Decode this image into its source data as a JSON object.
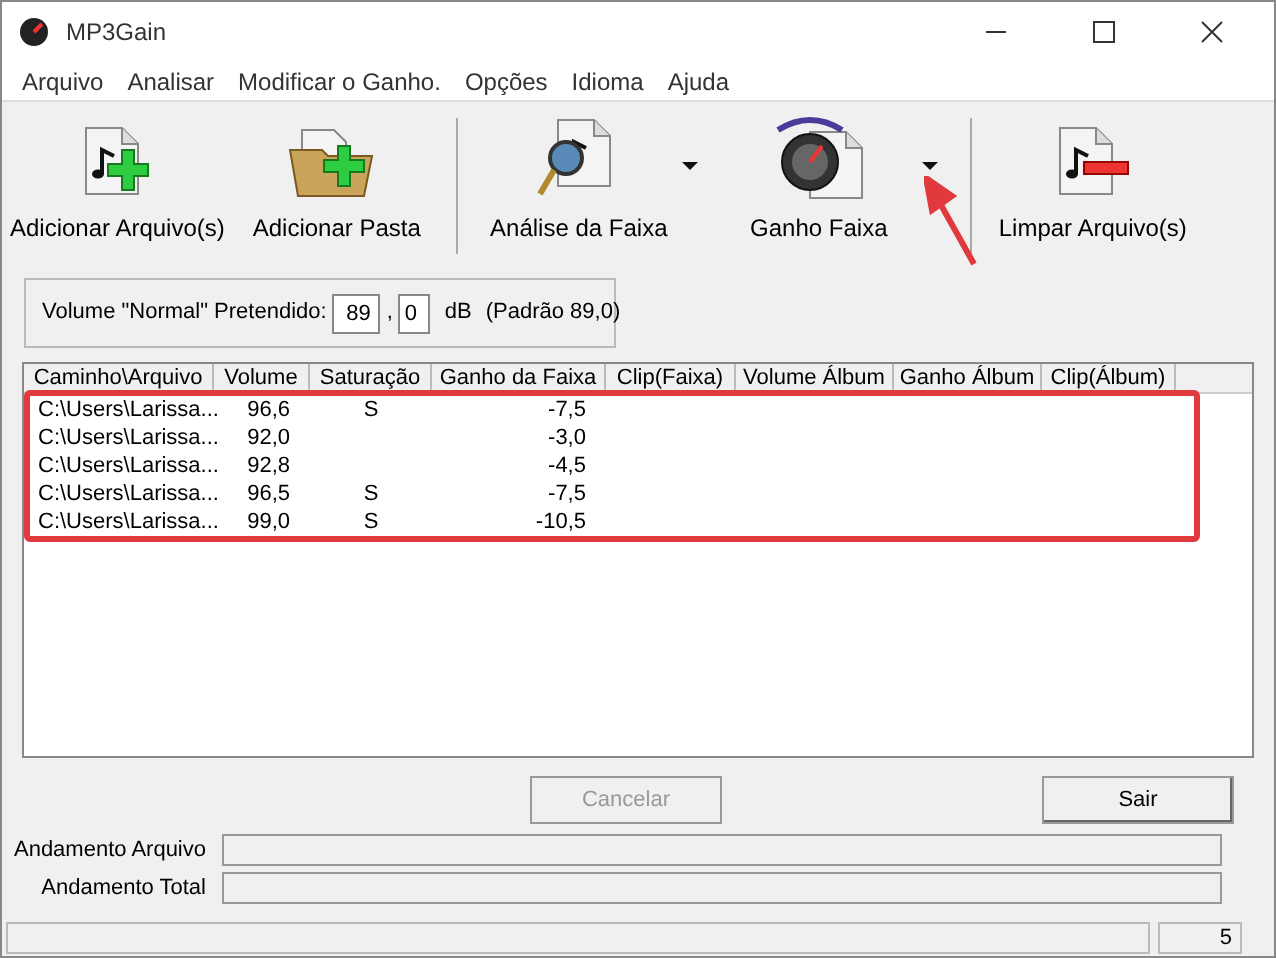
{
  "window": {
    "title": "MP3Gain"
  },
  "menu": [
    "Arquivo",
    "Analisar",
    "Modificar o Ganho.",
    "Opções",
    "Idioma",
    "Ajuda"
  ],
  "toolbar": [
    {
      "label": "Adicionar Arquivo(s)",
      "kind": "add-file",
      "dropdown": false
    },
    {
      "label": "Adicionar Pasta",
      "kind": "add-folder",
      "dropdown": false
    },
    {
      "label": "Análise da Faixa",
      "kind": "analyze",
      "dropdown": true
    },
    {
      "label": "Ganho Faixa",
      "kind": "gain",
      "dropdown": true
    },
    {
      "label": "Limpar Arquivo(s)",
      "kind": "clear",
      "dropdown": false
    }
  ],
  "target_volume": {
    "label": "Volume \"Normal\" Pretendido:",
    "integer": "89",
    "separator": ",",
    "decimal": "0",
    "unit": "dB",
    "default_note": "(Padrão 89,0)"
  },
  "table": {
    "columns": [
      "Caminho\\Arquivo",
      "Volume",
      "Saturação",
      "Ganho da Faixa",
      "Clip(Faixa)",
      "Volume Álbum",
      "Ganho Álbum",
      "Clip(Álbum)"
    ],
    "rows": [
      [
        "C:\\Users\\Larissa...",
        "96,6",
        "S",
        "-7,5"
      ],
      [
        "C:\\Users\\Larissa...",
        "92,0",
        "",
        "-3,0"
      ],
      [
        "C:\\Users\\Larissa...",
        "92,8",
        "",
        "-4,5"
      ],
      [
        "C:\\Users\\Larissa...",
        "96,5",
        "S",
        "-7,5"
      ],
      [
        "C:\\Users\\Larissa...",
        "99,0",
        "S",
        "-10,5"
      ]
    ]
  },
  "buttons": [
    {
      "label": "Cancelar",
      "disabled": true
    },
    {
      "label": "Sair",
      "disabled": false
    }
  ],
  "progress": [
    {
      "label": "Andamento Arquivo",
      "level": 0
    },
    {
      "label": "Andamento Total",
      "level": 0
    }
  ],
  "status_bar": {
    "count": "5"
  }
}
